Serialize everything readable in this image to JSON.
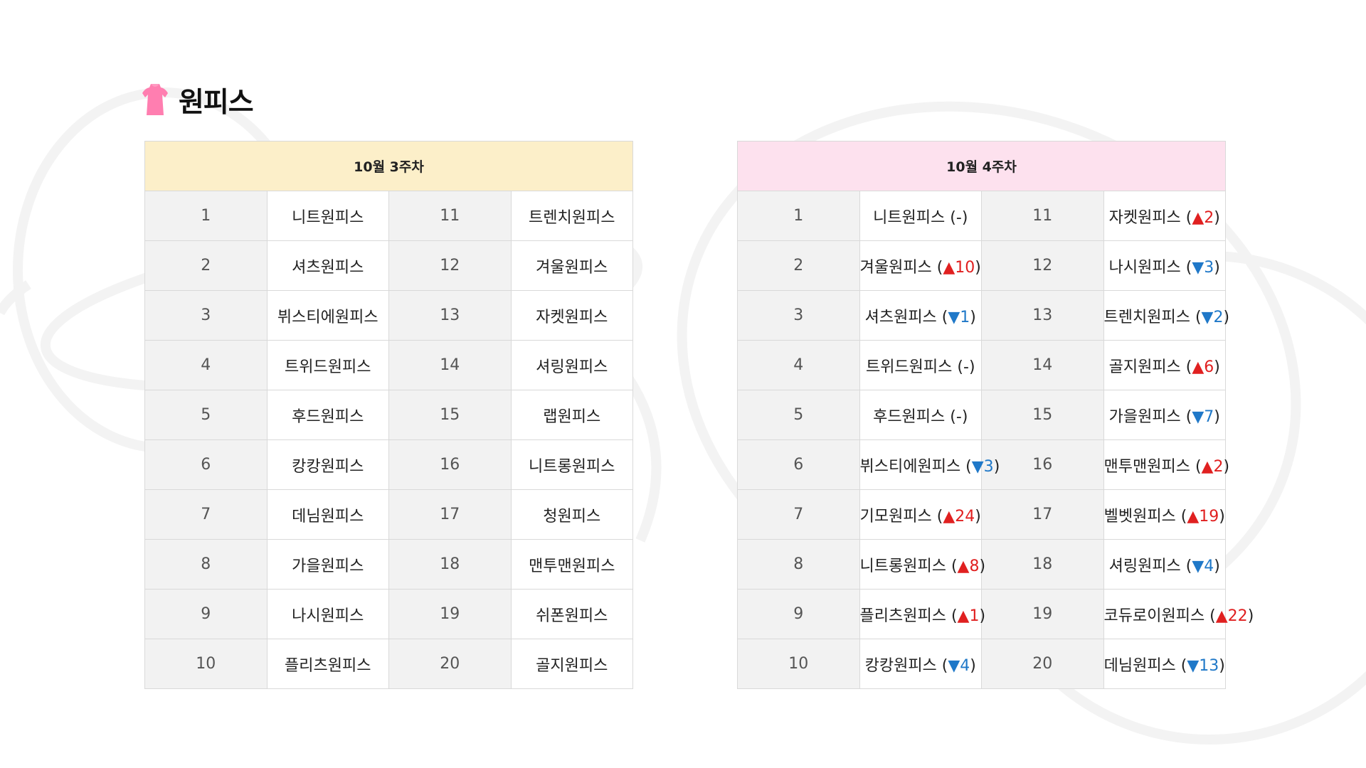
{
  "title": {
    "text": "원피스",
    "icon": "dress-icon"
  },
  "colors": {
    "icon": "#ff7eb0",
    "left_header": "#fcefc9",
    "right_header": "#fde1ee",
    "up": "#e02020",
    "down": "#1f78c8"
  },
  "week3": {
    "header": "10월 3주차",
    "rows": [
      {
        "rank1": "1",
        "name1": "니트원피스",
        "rank2": "11",
        "name2": "트렌치원피스"
      },
      {
        "rank1": "2",
        "name1": "셔츠원피스",
        "rank2": "12",
        "name2": "겨울원피스"
      },
      {
        "rank1": "3",
        "name1": "뷔스티에원피스",
        "rank2": "13",
        "name2": "자켓원피스"
      },
      {
        "rank1": "4",
        "name1": "트위드원피스",
        "rank2": "14",
        "name2": "셔링원피스"
      },
      {
        "rank1": "5",
        "name1": "후드원피스",
        "rank2": "15",
        "name2": "랩원피스"
      },
      {
        "rank1": "6",
        "name1": "캉캉원피스",
        "rank2": "16",
        "name2": "니트롱원피스"
      },
      {
        "rank1": "7",
        "name1": "데님원피스",
        "rank2": "17",
        "name2": "청원피스"
      },
      {
        "rank1": "8",
        "name1": "가을원피스",
        "rank2": "18",
        "name2": "맨투맨원피스"
      },
      {
        "rank1": "9",
        "name1": "나시원피스",
        "rank2": "19",
        "name2": "쉬폰원피스"
      },
      {
        "rank1": "10",
        "name1": "플리츠원피스",
        "rank2": "20",
        "name2": "골지원피스"
      }
    ]
  },
  "week4": {
    "header": "10월 4주차",
    "rows": [
      {
        "rank1": "1",
        "name1": "니트원피스",
        "change1": "-",
        "rank2": "11",
        "name2": "자켓원피스",
        "change2": "▲2"
      },
      {
        "rank1": "2",
        "name1": "겨울원피스",
        "change1": "▲10",
        "rank2": "12",
        "name2": "나시원피스",
        "change2": "▼3"
      },
      {
        "rank1": "3",
        "name1": "셔츠원피스",
        "change1": "▼1",
        "rank2": "13",
        "name2": "트렌치원피스",
        "change2": "▼2"
      },
      {
        "rank1": "4",
        "name1": "트위드원피스",
        "change1": "-",
        "rank2": "14",
        "name2": "골지원피스",
        "change2": "▲6"
      },
      {
        "rank1": "5",
        "name1": "후드원피스",
        "change1": "-",
        "rank2": "15",
        "name2": "가을원피스",
        "change2": "▼7"
      },
      {
        "rank1": "6",
        "name1": "뷔스티에원피스",
        "change1": "▼3",
        "rank2": "16",
        "name2": "맨투맨원피스",
        "change2": "▲2"
      },
      {
        "rank1": "7",
        "name1": "기모원피스",
        "change1": "▲24",
        "rank2": "17",
        "name2": "벨벳원피스",
        "change2": "▲19"
      },
      {
        "rank1": "8",
        "name1": "니트롱원피스",
        "change1": "▲8",
        "rank2": "18",
        "name2": "셔링원피스",
        "change2": "▼4"
      },
      {
        "rank1": "9",
        "name1": "플리츠원피스",
        "change1": "▲1",
        "rank2": "19",
        "name2": "코듀로이원피스",
        "change2": "▲22"
      },
      {
        "rank1": "10",
        "name1": "캉캉원피스",
        "change1": "▼4",
        "rank2": "20",
        "name2": "데님원피스",
        "change2": "▼13"
      }
    ]
  }
}
